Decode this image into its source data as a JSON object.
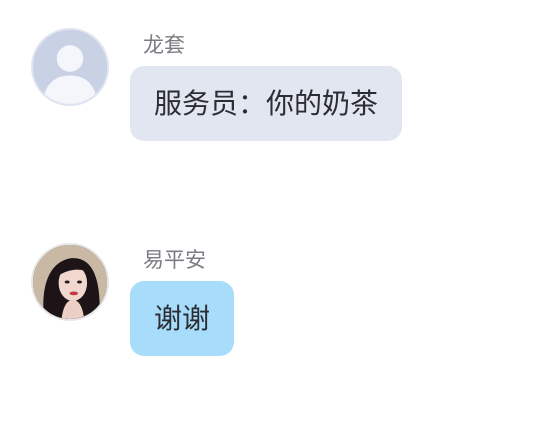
{
  "messages": [
    {
      "sender": "龙套",
      "text": "服务员：你的奶茶",
      "avatar_icon": "default-user-icon",
      "bubble_color": "#e2e6f1"
    },
    {
      "sender": "易平安",
      "text": "谢谢",
      "avatar_icon": "user-photo-avatar",
      "bubble_color": "#a8dcfb"
    }
  ]
}
